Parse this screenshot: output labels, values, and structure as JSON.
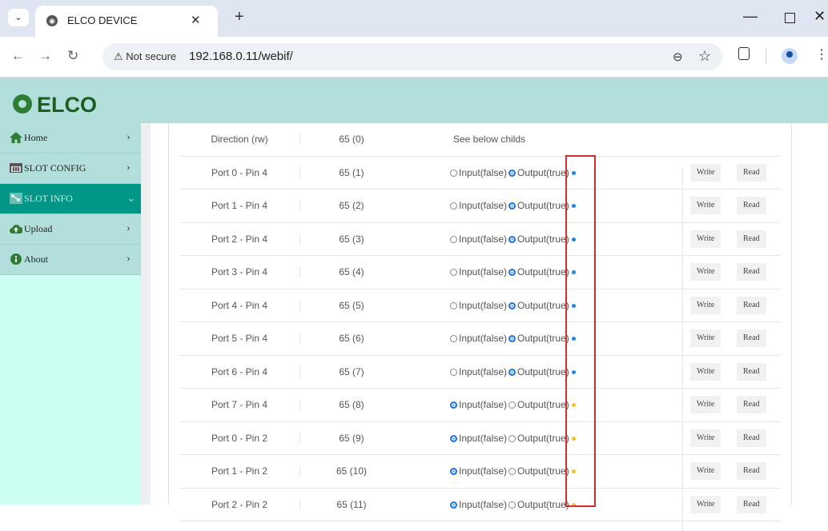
{
  "browser": {
    "tab_title": "ELCO DEVICE",
    "close_glyph": "✕",
    "new_tab_glyph": "+",
    "menu_glyph": "⌄",
    "security_text": "⚠ Not secure",
    "url": "192.168.0.11/webif/",
    "icons": [
      "back-icon",
      "forward-icon",
      "reload-icon",
      "zoom-icon",
      "star-icon",
      "extensions-icon",
      "profile-icon",
      "menu-icon"
    ]
  },
  "app": {
    "logo_text": "ELCO",
    "brand_color": "#009688"
  },
  "sidebar": {
    "items": [
      {
        "label": "Home",
        "icon": "home-icon"
      },
      {
        "label": "SLOT CONFIG",
        "icon": "slot-config-icon"
      },
      {
        "label": "SLOT INFO",
        "icon": "slot-info-icon",
        "active": true
      },
      {
        "label": "Upload",
        "icon": "upload-icon"
      },
      {
        "label": "About",
        "icon": "info-icon"
      }
    ]
  },
  "table": {
    "header": {
      "name": "Direction (rw)",
      "address": "65 (0)",
      "value": "See below childs"
    },
    "option_input": "Input(false)",
    "option_output": "Output(true)",
    "write_label": "Write",
    "read_label": "Read",
    "dot_colors": {
      "output": "#1e88e5",
      "input": "#fbc02d"
    },
    "rows": [
      {
        "name": "Port 0 - Pin 4",
        "address": "65 (1)",
        "selected": "output"
      },
      {
        "name": "Port 1 - Pin 4",
        "address": "65 (2)",
        "selected": "output"
      },
      {
        "name": "Port 2 - Pin 4",
        "address": "65 (3)",
        "selected": "output"
      },
      {
        "name": "Port 3 - Pin 4",
        "address": "65 (4)",
        "selected": "output"
      },
      {
        "name": "Port 4 - Pin 4",
        "address": "65 (5)",
        "selected": "output"
      },
      {
        "name": "Port 5 - Pin 4",
        "address": "65 (6)",
        "selected": "output"
      },
      {
        "name": "Port 6 - Pin 4",
        "address": "65 (7)",
        "selected": "output"
      },
      {
        "name": "Port 7 - Pin 4",
        "address": "65 (8)",
        "selected": "input"
      },
      {
        "name": "Port 0 - Pin 2",
        "address": "65 (9)",
        "selected": "input"
      },
      {
        "name": "Port 1 - Pin 2",
        "address": "65 (10)",
        "selected": "input"
      },
      {
        "name": "Port 2 - Pin 2",
        "address": "65 (11)",
        "selected": "input"
      }
    ]
  }
}
